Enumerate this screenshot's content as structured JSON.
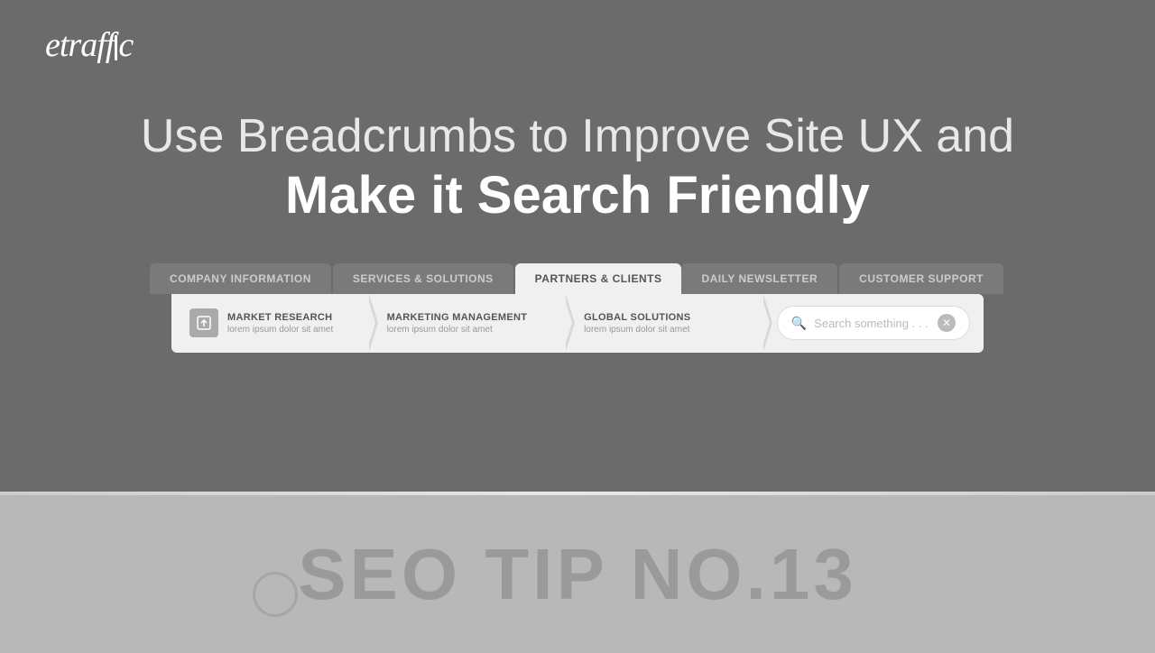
{
  "logo": {
    "text": "etraffic"
  },
  "headline": {
    "line1": "Use Breadcrumbs to Improve Site UX and",
    "line2": "Make it Search Friendly"
  },
  "nav_tabs": [
    {
      "label": "COMPANY INFORMATION",
      "active": false
    },
    {
      "label": "SERVICES & SOLUTIONS",
      "active": false
    },
    {
      "label": "PARTNERS & CLIENTS",
      "active": true
    },
    {
      "label": "DAILY NEWSLETTER",
      "active": false
    },
    {
      "label": "CUSTOMER SUPPORT",
      "active": false
    }
  ],
  "breadcrumb_items": [
    {
      "title": "MARKET RESEARCH",
      "subtitle": "lorem ipsum dolor sit amet",
      "has_icon": true
    },
    {
      "title": "MARKETING MANAGEMENT",
      "subtitle": "lorem ipsum dolor sit amet",
      "has_icon": false
    },
    {
      "title": "GLOBAL SOLUTIONS",
      "subtitle": "lorem ipsum dolor sit amet",
      "has_icon": false
    }
  ],
  "search": {
    "placeholder": "Search something . . ."
  },
  "bottom": {
    "seo_tip": "SEO TIP NO.13"
  }
}
